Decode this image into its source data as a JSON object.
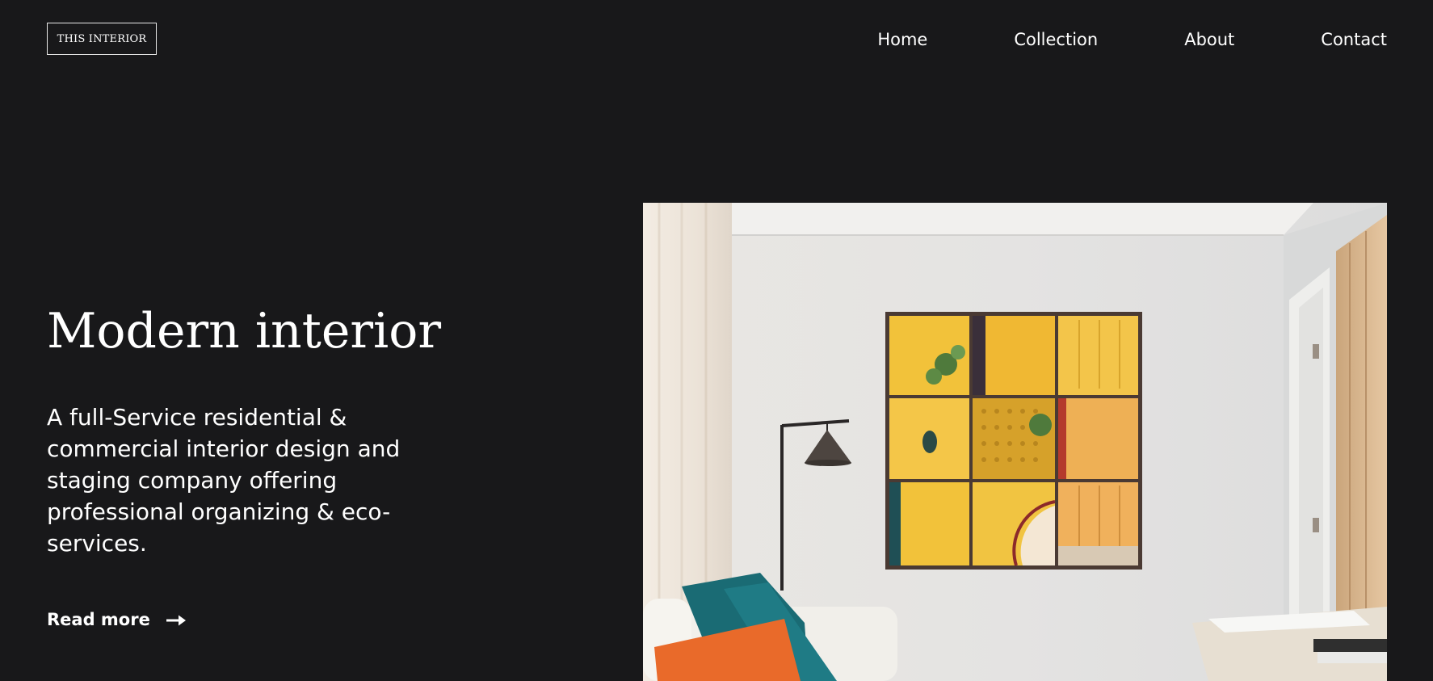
{
  "brand": {
    "logo_text": "THIS INTERIOR"
  },
  "nav": {
    "items": [
      {
        "label": "Home"
      },
      {
        "label": "Collection"
      },
      {
        "label": "About"
      },
      {
        "label": "Contact"
      }
    ]
  },
  "hero": {
    "title": "Modern interior",
    "description": "A full-Service residential & commercial interior design and staging company offering professional organizing & eco-services.",
    "cta_label": "Read more",
    "cta_icon": "arrow-right-icon",
    "image_icon": "living-room-photo"
  },
  "colors": {
    "background": "#18181a",
    "text": "#ffffff",
    "accent_yellow": "#f2c23a"
  }
}
